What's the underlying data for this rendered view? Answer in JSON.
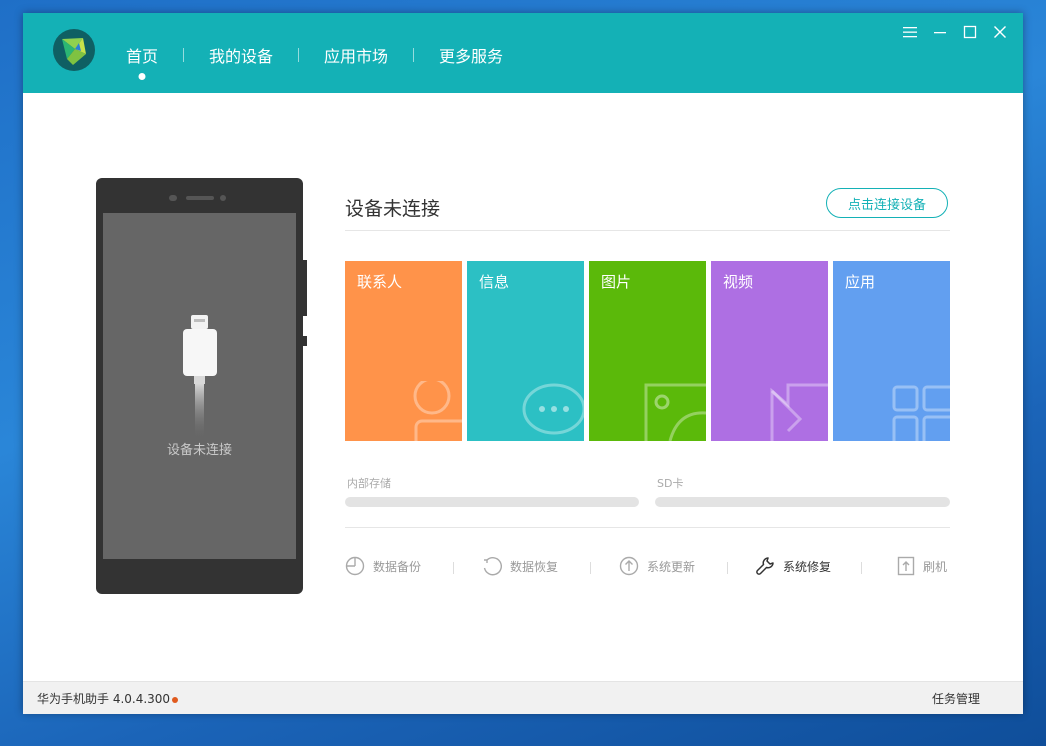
{
  "nav": {
    "items": [
      {
        "label": "首页",
        "active": true
      },
      {
        "label": "我的设备"
      },
      {
        "label": "应用市场"
      },
      {
        "label": "更多服务"
      }
    ]
  },
  "window_controls": {
    "menu_icon": "hamburger-icon",
    "min_icon": "minimize-icon",
    "max_icon": "maximize-icon",
    "close_icon": "close-icon"
  },
  "phone": {
    "screen_text": "设备未连接"
  },
  "device": {
    "status_title": "设备未连接",
    "connect_button": "点击连接设备"
  },
  "tiles": [
    {
      "label": "联系人",
      "color": "#ff934a",
      "icon": "contact-icon"
    },
    {
      "label": "信息",
      "color": "#2cc0c4",
      "icon": "message-icon"
    },
    {
      "label": "图片",
      "color": "#5bb90a",
      "icon": "picture-icon"
    },
    {
      "label": "视频",
      "color": "#ae6fe3",
      "icon": "video-icon"
    },
    {
      "label": "应用",
      "color": "#629ff0",
      "icon": "apps-icon"
    }
  ],
  "storage": {
    "internal_label": "内部存储",
    "sd_label": "SD卡"
  },
  "tools": [
    {
      "label": "数据备份",
      "icon": "backup-icon"
    },
    {
      "label": "数据恢复",
      "icon": "restore-icon"
    },
    {
      "label": "系统更新",
      "icon": "update-icon"
    },
    {
      "label": "系统修复",
      "icon": "wrench-icon",
      "active": true
    },
    {
      "label": "刷机",
      "icon": "flash-icon"
    }
  ],
  "statusbar": {
    "version": "华为手机助手 4.0.4.300",
    "task_manager": "任务管理"
  }
}
